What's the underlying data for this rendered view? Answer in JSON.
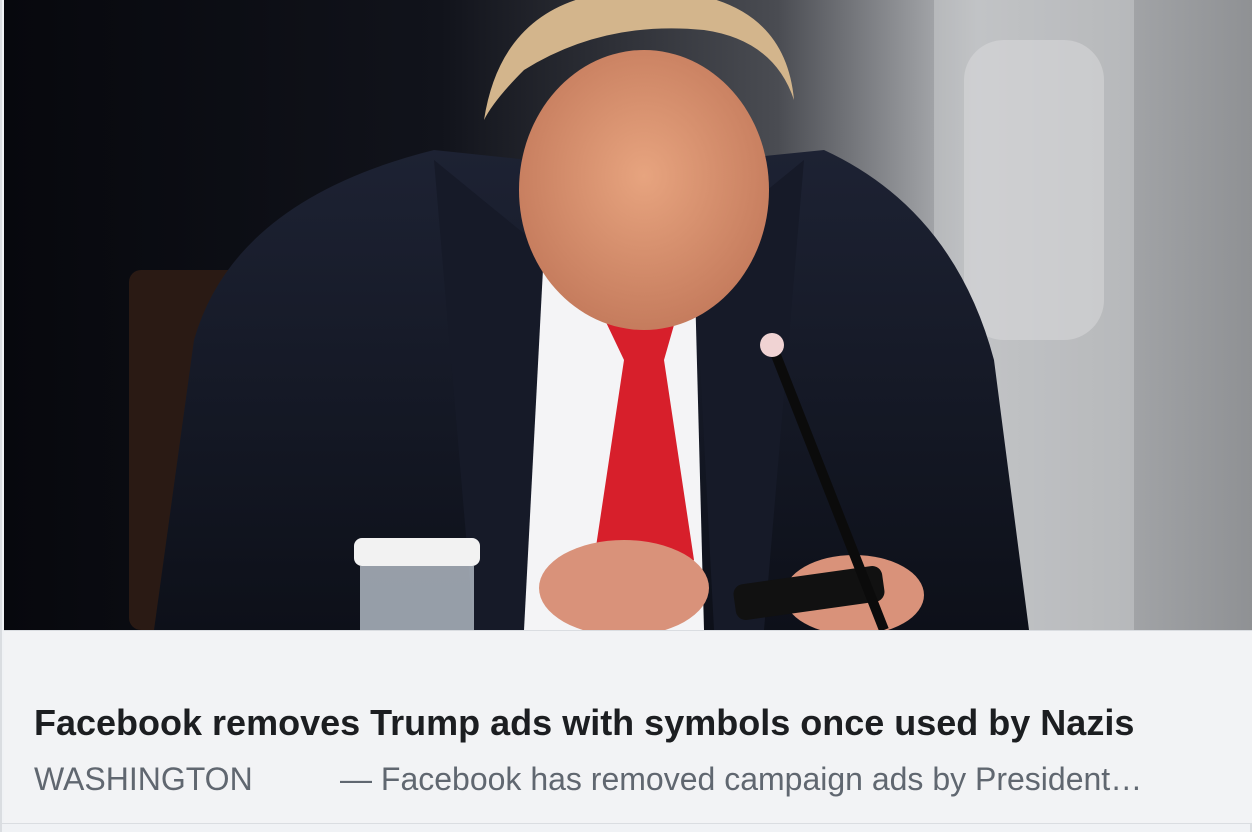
{
  "article": {
    "headline": "Facebook removes Trump ads with symbols once used by Nazis",
    "dateline": "WASHINGTON",
    "snippet": "— Facebook has removed campaign ads by President…"
  }
}
